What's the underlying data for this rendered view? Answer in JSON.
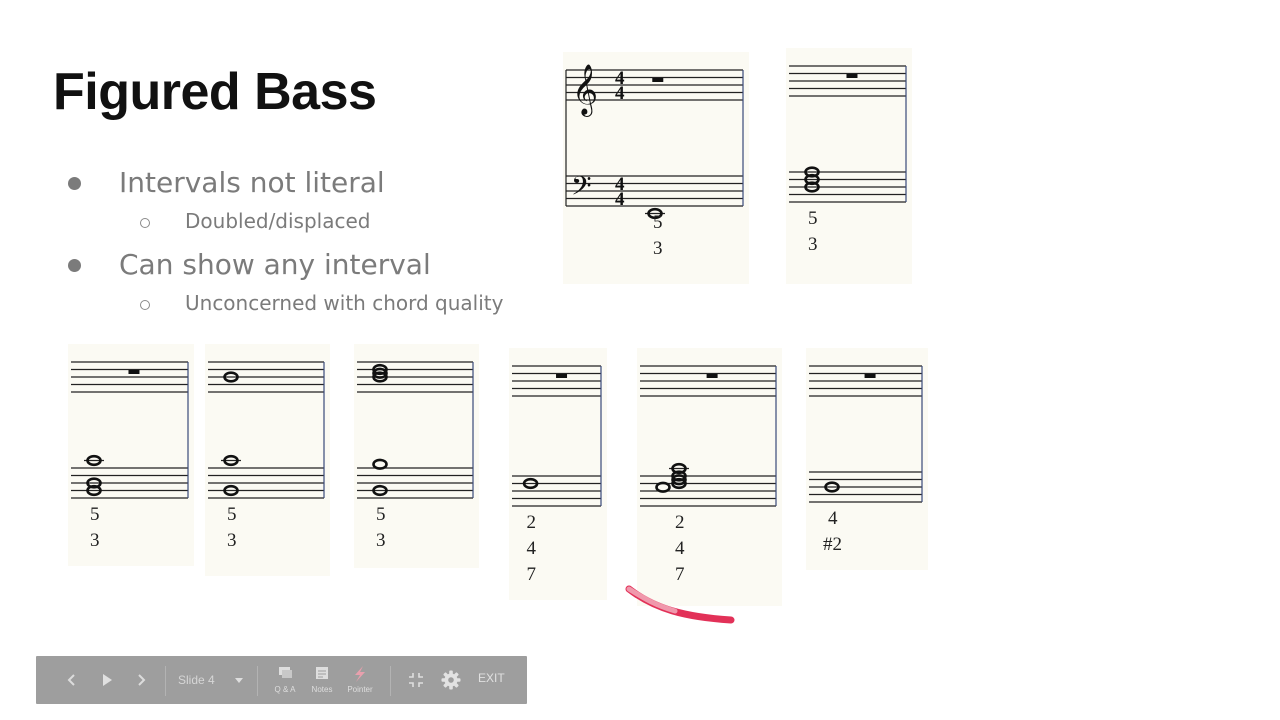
{
  "slide": {
    "title": "Figured Bass",
    "bullets": [
      {
        "level": 1,
        "text": "Intervals not literal"
      },
      {
        "level": 2,
        "text": "Doubled/displaced"
      },
      {
        "level": 1,
        "text": "Can show any interval"
      },
      {
        "level": 2,
        "text": "Unconcerned with chord quality"
      }
    ]
  },
  "examples": [
    {
      "id": "ex1",
      "clefs": true,
      "time": "4/4",
      "treble_rest": true,
      "treble_notes": [],
      "bass_notes": [
        {
          "step": -2,
          "x": 0
        }
      ],
      "figures": [
        "5",
        "3"
      ]
    },
    {
      "id": "ex2",
      "clefs": false,
      "treble_rest": true,
      "treble_notes": [],
      "bass_notes": [
        {
          "step": 4,
          "x": 0
        },
        {
          "step": 6,
          "x": 0
        },
        {
          "step": 8,
          "x": 0
        }
      ],
      "figures": [
        "5",
        "3"
      ]
    },
    {
      "id": "ex3",
      "clefs": false,
      "treble_rest": true,
      "treble_notes": [],
      "bass_notes": [
        {
          "step": 2,
          "x": 0
        },
        {
          "step": 4,
          "x": 0
        },
        {
          "step": 10,
          "x": 0
        }
      ],
      "figures": [
        "5",
        "3"
      ]
    },
    {
      "id": "ex4",
      "clefs": false,
      "treble_rest": false,
      "treble_notes": [
        {
          "step": 4,
          "x": 0
        }
      ],
      "bass_notes": [
        {
          "step": 2,
          "x": 0
        },
        {
          "step": 10,
          "x": 0
        }
      ],
      "figures": [
        "5",
        "3"
      ]
    },
    {
      "id": "ex5",
      "clefs": false,
      "treble_rest": false,
      "treble_notes": [
        {
          "step": 4,
          "x": 0
        },
        {
          "step": 5,
          "x": 0
        },
        {
          "step": 6,
          "x": 0
        }
      ],
      "bass_notes": [
        {
          "step": 2,
          "x": 0
        },
        {
          "step": 9,
          "x": 0
        }
      ],
      "figures": [
        "5",
        "3"
      ]
    },
    {
      "id": "ex6",
      "clefs": false,
      "treble_rest": true,
      "treble_notes": [],
      "bass_notes": [
        {
          "step": 6,
          "x": 0
        }
      ],
      "figures": [
        "2",
        "4",
        "7"
      ]
    },
    {
      "id": "ex7",
      "clefs": false,
      "treble_rest": true,
      "treble_notes": [],
      "bass_notes": [
        {
          "step": 5,
          "x": 0
        },
        {
          "step": 6,
          "x": 1
        },
        {
          "step": 7,
          "x": 1
        },
        {
          "step": 8,
          "x": 1
        },
        {
          "step": 10,
          "x": 1
        }
      ],
      "figures": [
        "2",
        "4",
        "7"
      ]
    },
    {
      "id": "ex8",
      "clefs": false,
      "treble_rest": true,
      "treble_notes": [],
      "bass_notes": [
        {
          "step": 4,
          "x": 0
        }
      ],
      "figures": [
        "4",
        "#2"
      ]
    }
  ],
  "toolbar": {
    "prev_icon": "chevron-left-icon",
    "play_icon": "play-icon",
    "next_icon": "chevron-right-icon",
    "slide_select": "Slide 4",
    "qa_label": "Q & A",
    "notes_label": "Notes",
    "pointer_label": "Pointer",
    "exit_label": "EXIT",
    "pointer_color": "#e8a0ad"
  },
  "colors": {
    "laser": "#e0204a",
    "bullet_text": "#7b7b7b",
    "panel_bg": "#fbfaf3",
    "barline": "#3a4a7a"
  }
}
